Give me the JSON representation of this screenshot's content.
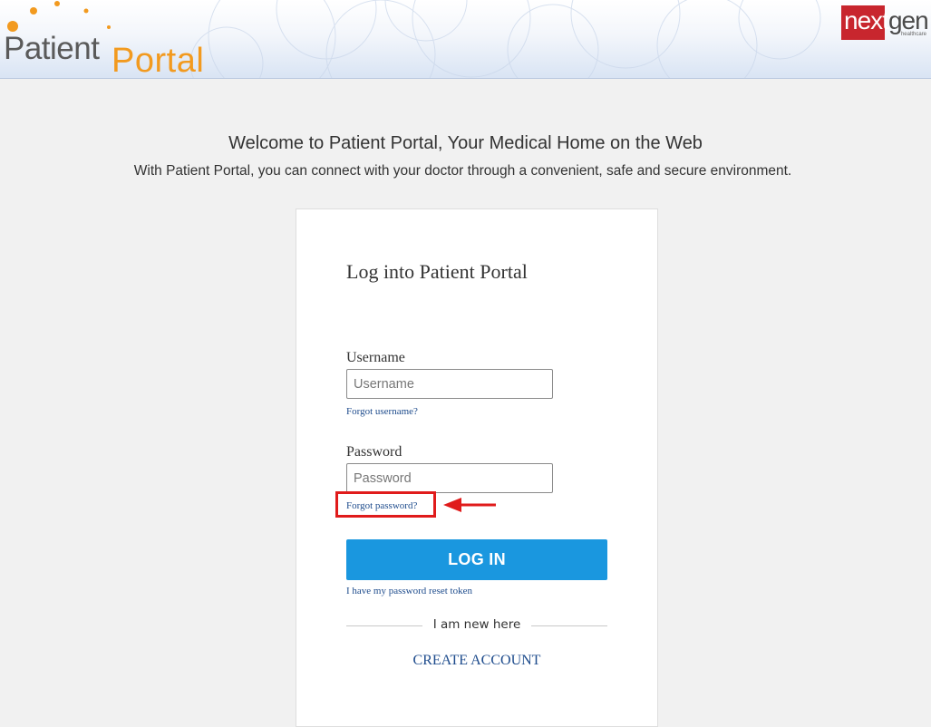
{
  "header": {
    "logo_word1": "Patient",
    "logo_word2": "Portal",
    "brand_logo": {
      "part1": "next",
      "part2": "gen",
      "sub": "healthcare"
    }
  },
  "welcome": {
    "title": "Welcome to Patient Portal, Your Medical Home on the Web",
    "subtitle": "With Patient Portal, you can connect with your doctor through a convenient, safe and secure environment."
  },
  "login": {
    "title": "Log into Patient Portal",
    "username_label": "Username",
    "username_placeholder": "Username",
    "username_value": "",
    "forgot_username": "Forgot username?",
    "password_label": "Password",
    "password_placeholder": "Password",
    "password_value": "",
    "forgot_password": "Forgot password?",
    "login_button": "LOG IN",
    "reset_token_link": "I have my password reset token",
    "new_here": "I am new here",
    "create_account": "CREATE ACCOUNT"
  },
  "colors": {
    "accent_blue": "#1a97df",
    "link_blue": "#1d4b8c",
    "logo_orange": "#f29a1f",
    "annotation_red": "#e01b1b",
    "brand_red": "#c8262e"
  },
  "icons": {
    "annotation_arrow": "left-arrow-icon"
  }
}
